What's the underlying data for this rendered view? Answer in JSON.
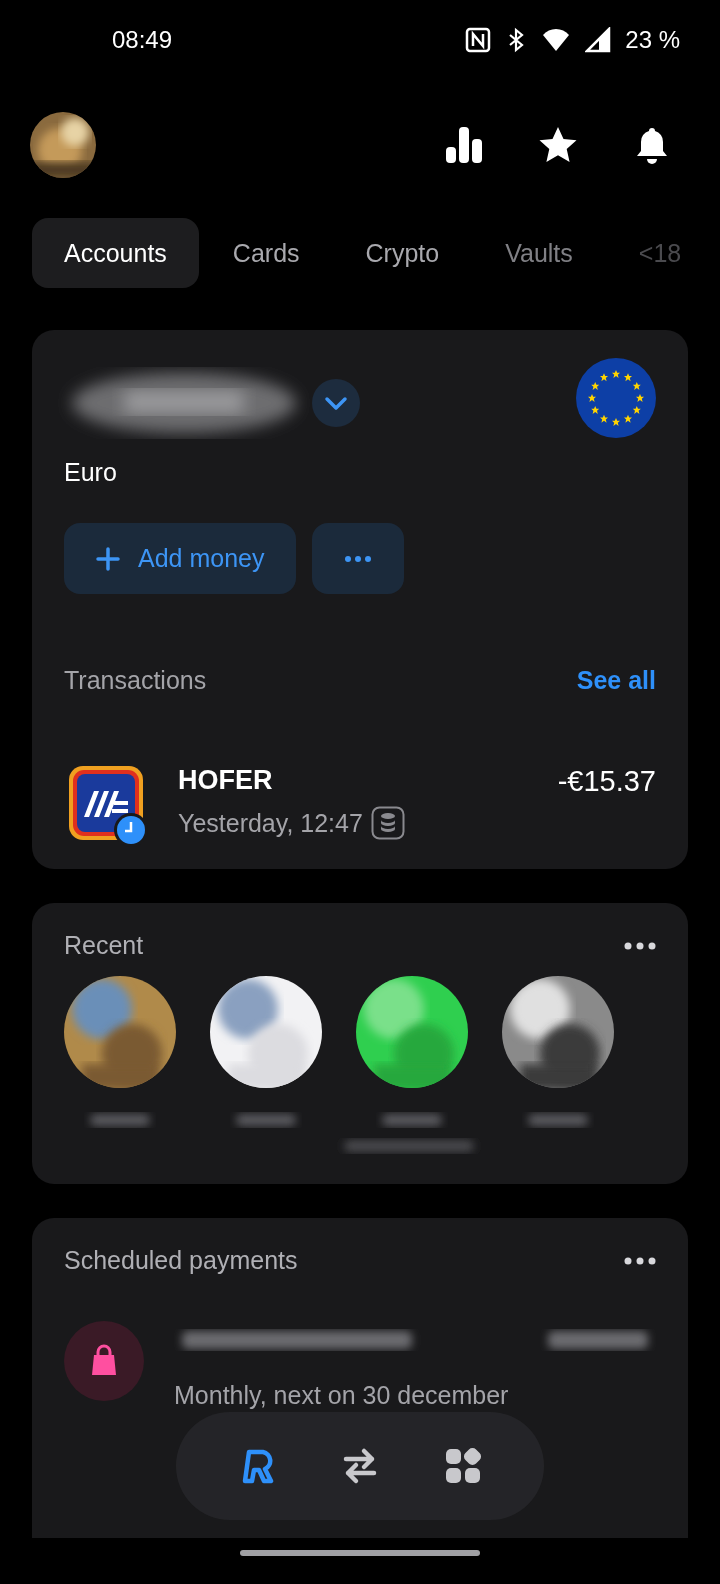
{
  "status_bar": {
    "time": "08:49",
    "battery": "23 %"
  },
  "tabs": [
    {
      "label": "Accounts",
      "selected": true
    },
    {
      "label": "Cards",
      "selected": false
    },
    {
      "label": "Crypto",
      "selected": false
    },
    {
      "label": "Vaults",
      "selected": false
    },
    {
      "label": "<18",
      "selected": false
    }
  ],
  "account": {
    "currency": "Euro",
    "buttons": [
      {
        "kind": "add",
        "label": "Add money"
      },
      {
        "kind": "more"
      }
    ]
  },
  "transactions": {
    "title": "Transactions",
    "link": "See all",
    "items": [
      {
        "merchant": "HOFER",
        "time": "Yesterday, 12:47",
        "amount": "-€15.37"
      }
    ]
  },
  "recent": {
    "title": "Recent"
  },
  "scheduled": {
    "title": "Scheduled payments",
    "items": [
      {
        "detail": "Monthly, next on 30 december"
      }
    ]
  },
  "nav": [
    {
      "kind": "home",
      "selected": true
    },
    {
      "kind": "transfer",
      "selected": false
    },
    {
      "kind": "hub",
      "selected": false
    }
  ]
}
